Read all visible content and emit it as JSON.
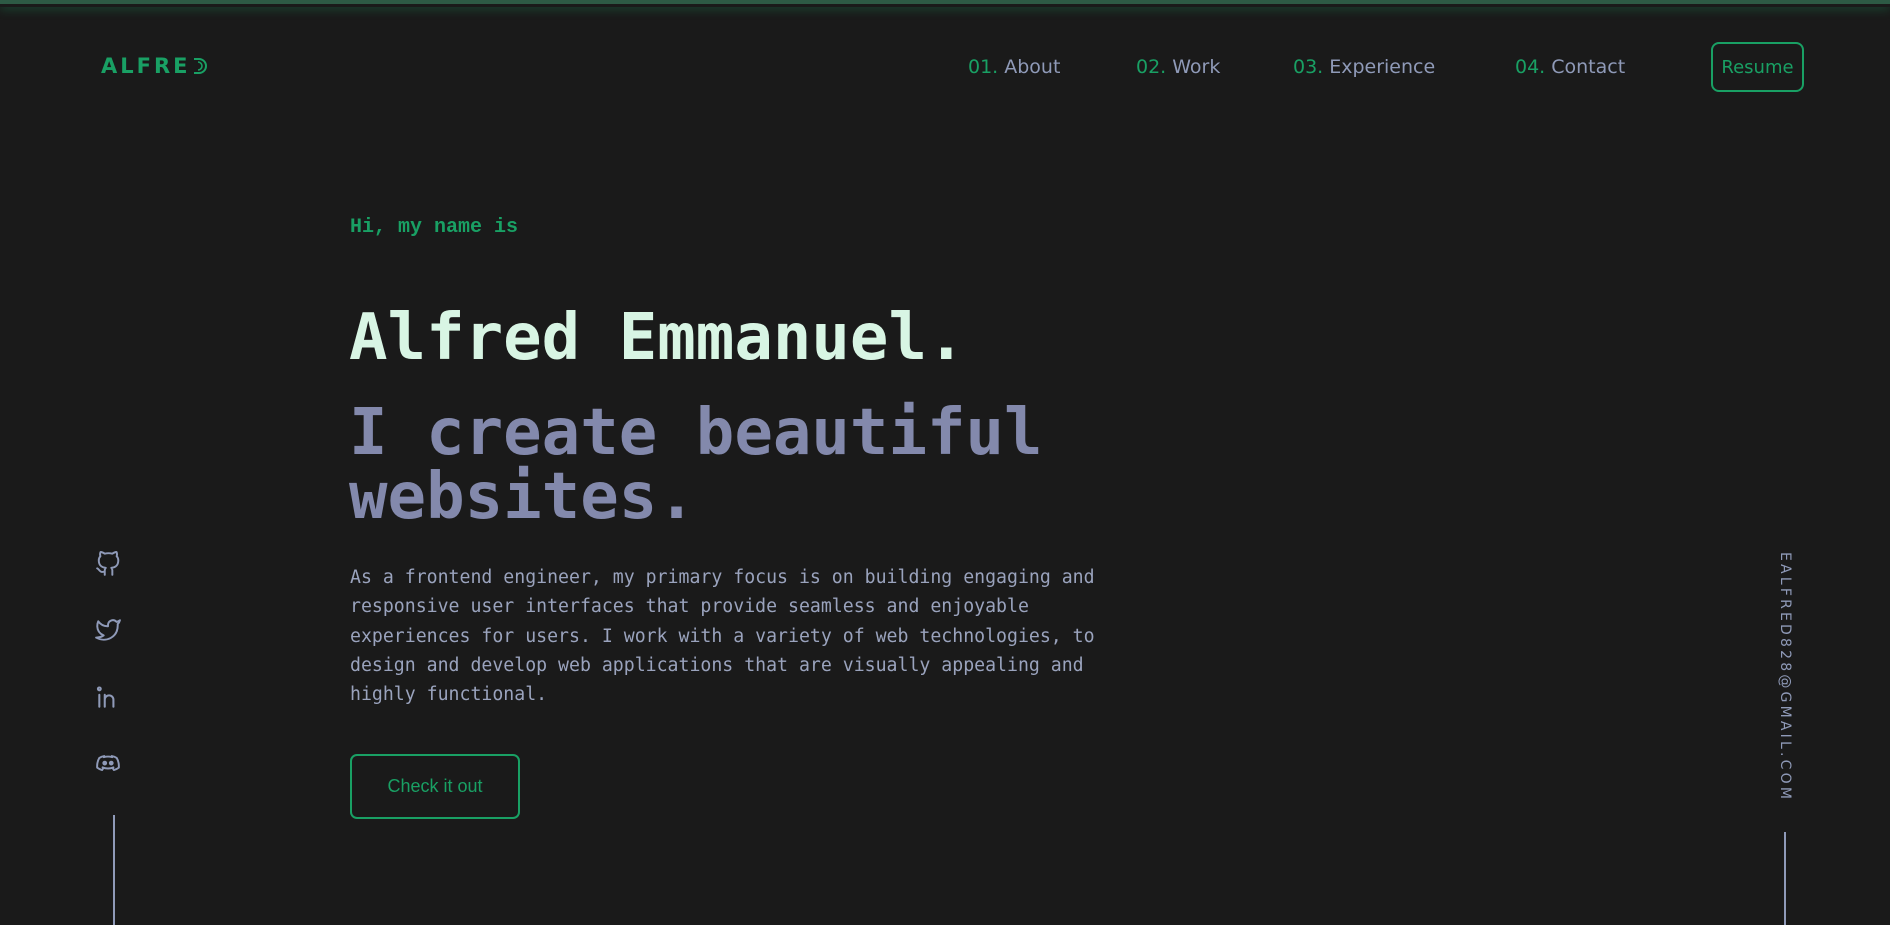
{
  "logo": {
    "text": "ALFRE",
    "icon": "crescent-d-icon"
  },
  "nav": {
    "items": [
      {
        "num": "01.",
        "label": "About"
      },
      {
        "num": "02.",
        "label": "Work"
      },
      {
        "num": "03.",
        "label": "Experience"
      },
      {
        "num": "04.",
        "label": "Contact"
      }
    ],
    "resume_label": "Resume"
  },
  "hero": {
    "intro": "Hi, my name is",
    "name": "Alfred Emmanuel.",
    "tagline": "I create beautiful websites.",
    "bio": "As a frontend engineer, my primary focus is on building engaging and responsive user interfaces that provide seamless and enjoyable experiences for users. I work with a variety of web technologies, to design and develop web applications that are visually appealing and highly functional.",
    "cta_label": "Check it out"
  },
  "social": [
    "github-icon",
    "twitter-icon",
    "linkedin-icon",
    "discord-icon"
  ],
  "email": "EALFRED828@GMAIL.COM",
  "colors": {
    "background": "#1a1a1a",
    "accent": "#19a064",
    "name": "#d8f5e4",
    "tagline": "#8389ac",
    "muted": "#8f9ab8"
  }
}
